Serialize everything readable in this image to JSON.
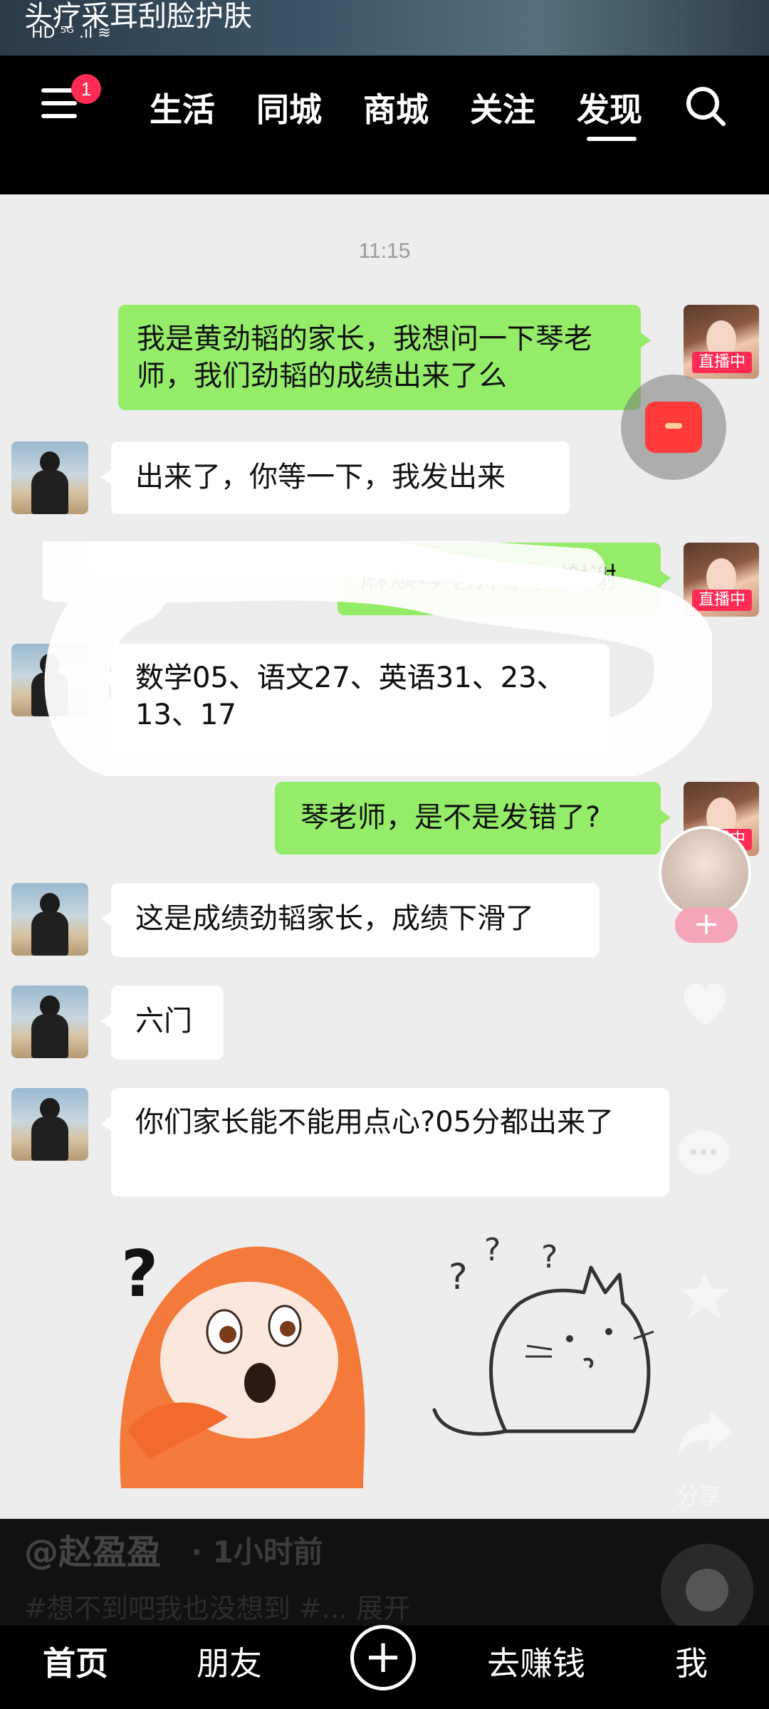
{
  "banner": {
    "title": "头疗采耳刮脸护肤",
    "status_icons": "HD ⁵ᴳ .ıl ≋"
  },
  "topnav": {
    "menu_badge": "1",
    "tabs": [
      "生活",
      "同城",
      "商城",
      "关注",
      "发现"
    ],
    "active_tab": "发现"
  },
  "chat": {
    "timestamp": "11:15",
    "live_badge": "直播中",
    "messages": [
      {
        "side": "right",
        "text": "我是黄劲韬的家长，我想问一下琴老师，我们劲韬的成绩出来了么"
      },
      {
        "side": "left",
        "text": "出来了，你等一下，我发出来"
      },
      {
        "side": "right",
        "text": "麻烦琴老师了，谢谢"
      },
      {
        "side": "left",
        "text": "数学05、语文27、英语31、23、13、17"
      },
      {
        "side": "right",
        "text": "琴老师，是不是发错了?"
      },
      {
        "side": "left",
        "text": "这是成绩劲韬家长，成绩下滑了"
      },
      {
        "side": "left",
        "text": "六门"
      },
      {
        "side": "left",
        "text": "你们家长能不能用点心?05分都出来了"
      }
    ]
  },
  "overlay": {
    "follow_plus": "+",
    "share_label": "分享"
  },
  "info": {
    "author": "@赵盈盈",
    "time_ago": "· 1小时前",
    "caption": "#想不到吧我也没想到 #... 展开"
  },
  "bottomnav": {
    "home": "首页",
    "friends": "朋友",
    "add": "+",
    "earn": "去赚钱",
    "me": "我"
  },
  "colors": {
    "right_bubble": "#95ec69",
    "left_bubble": "#ffffff",
    "chat_bg": "#ededed",
    "accent": "#fe2c55"
  }
}
